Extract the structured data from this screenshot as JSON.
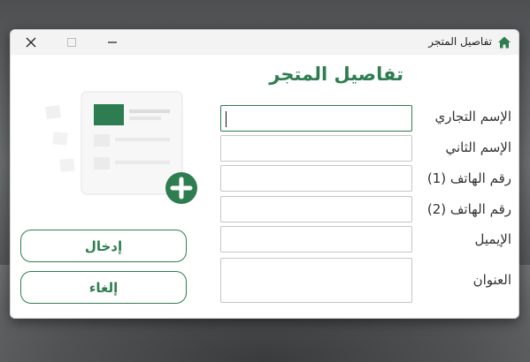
{
  "window": {
    "title": "تفاصيل المتجر"
  },
  "heading": "تفاصيل المتجر",
  "fields": [
    {
      "label": "الإسم التجاري",
      "value": ""
    },
    {
      "label": "الإسم الثاني",
      "value": ""
    },
    {
      "label": "رقم الهاتف (1)",
      "value": ""
    },
    {
      "label": "رقم الهاتف (2)",
      "value": ""
    },
    {
      "label": "الإيميل",
      "value": ""
    },
    {
      "label": "العنوان",
      "value": ""
    }
  ],
  "buttons": {
    "submit": "إدخال",
    "cancel": "إلغاء"
  },
  "colors": {
    "accent": "#2e7d50",
    "illustration": "#e6e6e6"
  },
  "icons": {
    "app": "home-icon",
    "add": "plus-circle-icon"
  }
}
